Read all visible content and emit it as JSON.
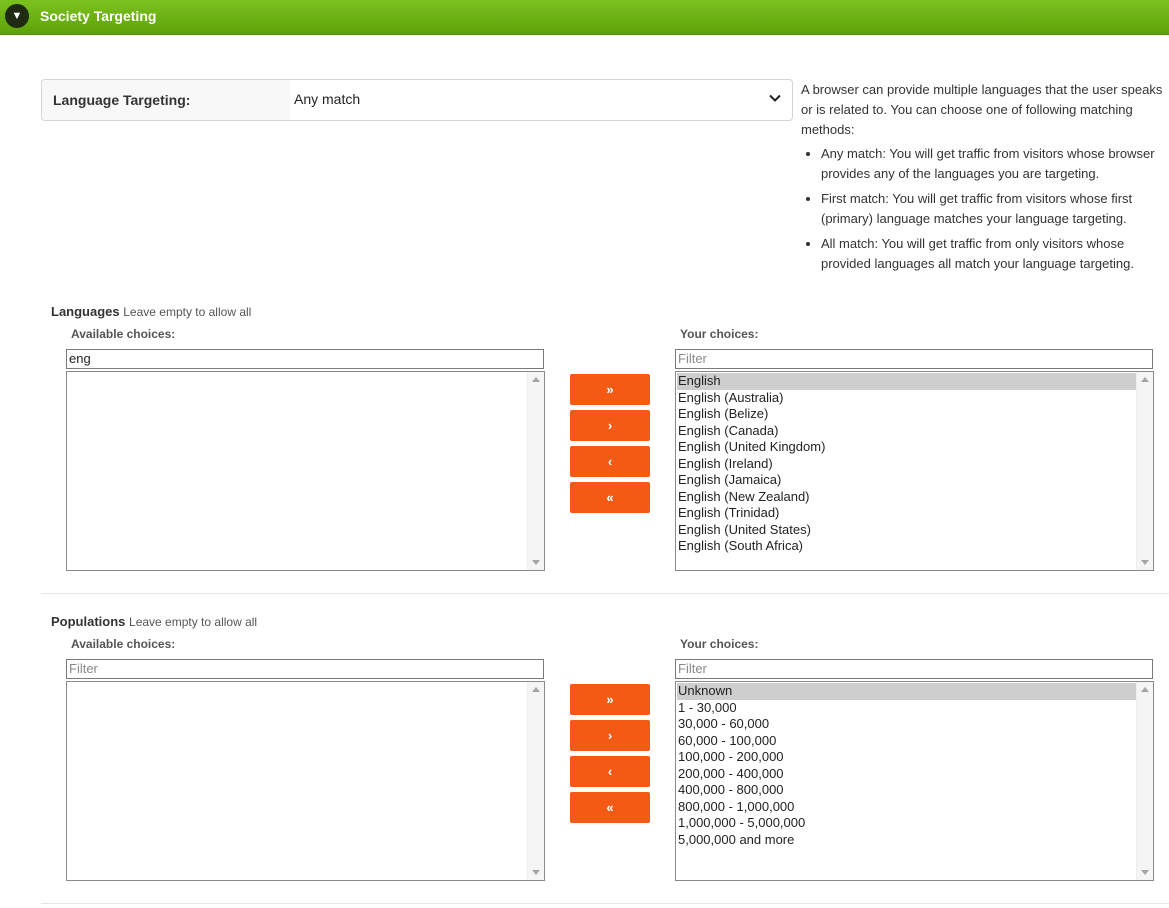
{
  "header": {
    "toggle_glyph": "▼",
    "title": "Society Targeting"
  },
  "language_targeting": {
    "label": "Language Targeting:",
    "selected": "Any match"
  },
  "help": {
    "intro": "A browser can provide multiple languages that the user speaks or is related to. You can choose one of following matching methods:",
    "bullets": [
      "Any match: You will get traffic from visitors whose browser provides any of the languages you are targeting.",
      "First match: You will get traffic from visitors whose first (primary) language matches your language targeting.",
      "All match: You will get traffic from only visitors whose provided languages all match your language targeting."
    ]
  },
  "buttons": {
    "add_all": "»",
    "add": "›",
    "remove": "‹",
    "remove_all": "«"
  },
  "languages": {
    "title": "Languages",
    "hint": "Leave empty to allow all",
    "available_label": "Available choices:",
    "available_filter_value": "eng",
    "available_items": [],
    "chosen_label": "Your choices:",
    "chosen_filter_placeholder": "Filter",
    "chosen_items": [
      "English",
      "English (Australia)",
      "English (Belize)",
      "English (Canada)",
      "English (United Kingdom)",
      "English (Ireland)",
      "English (Jamaica)",
      "English (New Zealand)",
      "English (Trinidad)",
      "English (United States)",
      "English (South Africa)"
    ]
  },
  "populations": {
    "title": "Populations",
    "hint": "Leave empty to allow all",
    "available_label": "Available choices:",
    "available_filter_placeholder": "Filter",
    "available_items": [],
    "chosen_label": "Your choices:",
    "chosen_filter_placeholder": "Filter",
    "chosen_items": [
      "Unknown",
      "1 - 30,000",
      "30,000 - 60,000",
      "60,000 - 100,000",
      "100,000 - 200,000",
      "200,000 - 400,000",
      "400,000 - 800,000",
      "800,000 - 1,000,000",
      "1,000,000 - 5,000,000",
      "5,000,000 and more"
    ]
  }
}
